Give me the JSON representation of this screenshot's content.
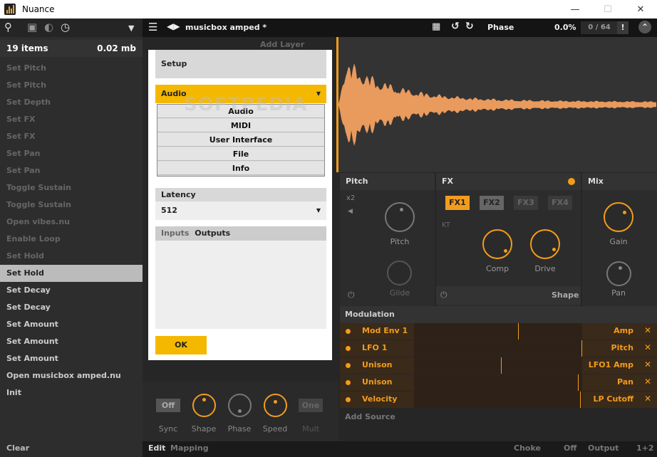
{
  "window": {
    "title": "Nuance",
    "minimize": "—",
    "maximize": "☐",
    "close": "✕"
  },
  "sidebar": {
    "header_count": "19 items",
    "header_size": "0.02 mb",
    "items": [
      "Set Pitch",
      "Set Pitch",
      "Set Depth",
      "Set FX",
      "Set FX",
      "Set Pan",
      "Set Pan",
      "Toggle Sustain",
      "Toggle Sustain",
      "Open vibes.nu",
      "Enable Loop",
      "Set Hold",
      "Set Hold",
      "Set Decay",
      "Set Decay",
      "Set Amount",
      "Set Amount",
      "Set Amount",
      "Open musicbox amped.nu",
      "Init"
    ],
    "selected_index": 12,
    "clear_label": "Clear"
  },
  "toolbar": {
    "file_name": "musicbox amped *",
    "phase_label": "Phase",
    "phase_value": "0.0%",
    "voices": "0 / 64",
    "warn": "!",
    "add_layer": "Add Layer"
  },
  "pitch": {
    "title": "Pitch",
    "x2": "x2",
    "pitch_label": "Pitch",
    "glide_label": "Glide"
  },
  "fx": {
    "title": "FX",
    "tabs": [
      "FX1",
      "FX2",
      "FX3",
      "FX4"
    ],
    "kt": "KT",
    "comp_label": "Comp",
    "drive_label": "Drive",
    "shape_label": "Shape"
  },
  "mix": {
    "title": "Mix",
    "gain_label": "Gain",
    "pan_label": "Pan"
  },
  "modulation": {
    "title": "Modulation",
    "rows": [
      {
        "source": "Mod Env 1",
        "target": "Amp",
        "amount": 0.62
      },
      {
        "source": "LFO 1",
        "target": "Pitch",
        "amount": 1.0
      },
      {
        "source": "Unison",
        "target": "LFO1 Amp",
        "amount": 0.52
      },
      {
        "source": "Unison",
        "target": "Pan",
        "amount": 0.98
      },
      {
        "source": "Velocity",
        "target": "LP Cutoff",
        "amount": 0.99
      }
    ],
    "add_source": "Add Source"
  },
  "lfo": {
    "sync_value": "Off",
    "sync_label": "Sync",
    "shape_label": "Shape",
    "phase_label": "Phase",
    "speed_label": "Speed",
    "mult_value": "One",
    "mult_label": "Mult"
  },
  "bottombar": {
    "edit": "Edit",
    "mapping": "Mapping",
    "choke": "Choke",
    "off": "Off",
    "output": "Output",
    "output_value": "1+2"
  },
  "dialog": {
    "setup_title": "Setup",
    "category_selected": "Audio",
    "category_options": [
      "Audio",
      "MIDI",
      "User Interface",
      "File",
      "Info"
    ],
    "latency_label": "Latency",
    "latency_value": "512",
    "tab_inputs": "Inputs",
    "tab_outputs": "Outputs",
    "ok_label": "OK"
  },
  "watermark": "SOFTPEDIA",
  "colors": {
    "accent": "#f39c1c",
    "selected_row": "#bbbbbb",
    "dialog_yellow": "#f5b800"
  }
}
